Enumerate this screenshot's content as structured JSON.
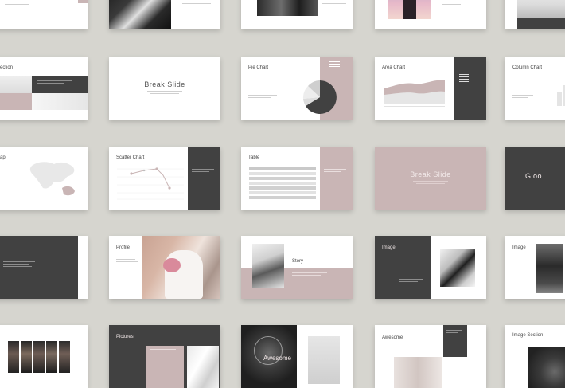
{
  "slides": {
    "r1c1": {
      "title": ""
    },
    "r2c1": {
      "title": "ection"
    },
    "r2c2": {
      "title": "Break Slide"
    },
    "r2c3": {
      "title": "Pie Chart"
    },
    "r2c4": {
      "title": "Area Chart"
    },
    "r2c5": {
      "title": "Column Chart"
    },
    "r3c1": {
      "title": "ap"
    },
    "r3c2": {
      "title": "Scatter Chart"
    },
    "r3c3": {
      "title": "Table"
    },
    "r3c4": {
      "title": "Break Slide"
    },
    "r3c5": {
      "title": "Gloo"
    },
    "r4c2": {
      "title": "Profile"
    },
    "r4c3": {
      "title": "Story"
    },
    "r4c4": {
      "title": "Image"
    },
    "r4c5": {
      "title": "Image"
    },
    "r5c2": {
      "title": "Pictures"
    },
    "r5c3": {
      "title": "Awesome"
    },
    "r5c4": {
      "title": "Awesome"
    },
    "r5c5": {
      "title": "Image Section"
    }
  },
  "colors": {
    "background": "#d6d5cf",
    "pink": "#c9b5b5",
    "dark": "#414141",
    "white": "#ffffff"
  }
}
